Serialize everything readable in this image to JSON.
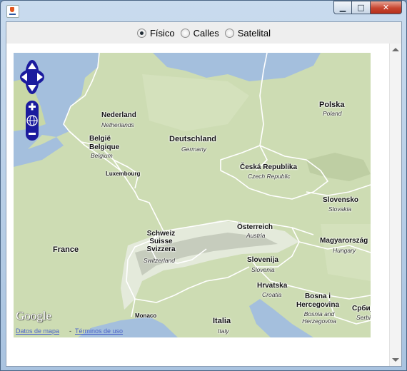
{
  "window": {
    "controls": {
      "minimize": "▁",
      "maximize": "□",
      "close": "✕"
    }
  },
  "map_type": {
    "options": [
      {
        "label": "Físico",
        "selected": true
      },
      {
        "label": "Calles",
        "selected": false
      },
      {
        "label": "Satelital",
        "selected": false
      }
    ]
  },
  "map": {
    "labels": [
      {
        "name": "Polska",
        "sub": "Poland"
      },
      {
        "name": "Nederland",
        "sub": "Netherlands"
      },
      {
        "name": "Deutschland",
        "sub": "Germany"
      },
      {
        "name": "België Belgique",
        "sub": "Belgium"
      },
      {
        "name": "Česká Republika",
        "sub": "Czech Republic"
      },
      {
        "name": "Luxembourg",
        "sub": ""
      },
      {
        "name": "Slovensko",
        "sub": "Slovakia"
      },
      {
        "name": "Österreich",
        "sub": "Austria"
      },
      {
        "name": "Schweiz Suisse Svizzera",
        "sub": "Switzerland"
      },
      {
        "name": "Magyarország",
        "sub": "Hungary"
      },
      {
        "name": "France",
        "sub": ""
      },
      {
        "name": "Slovenija",
        "sub": "Slovenia"
      },
      {
        "name": "Hrvatska",
        "sub": "Croatia"
      },
      {
        "name": "Bosna i Hercegovina",
        "sub": "Bosnia and Herzegovina"
      },
      {
        "name": "Monaco",
        "sub": ""
      },
      {
        "name": "Italia",
        "sub": "Italy"
      },
      {
        "name": "Србиј",
        "sub": "Serbi"
      }
    ],
    "logo": "Google",
    "links": {
      "map_data": "Datos de mapa",
      "separator": "-",
      "terms": "Términos de uso"
    }
  },
  "colors": {
    "sea": "#a4bfdd",
    "land": "#cddcb3",
    "border": "#ffffff",
    "controls": "#1b1b9e"
  }
}
